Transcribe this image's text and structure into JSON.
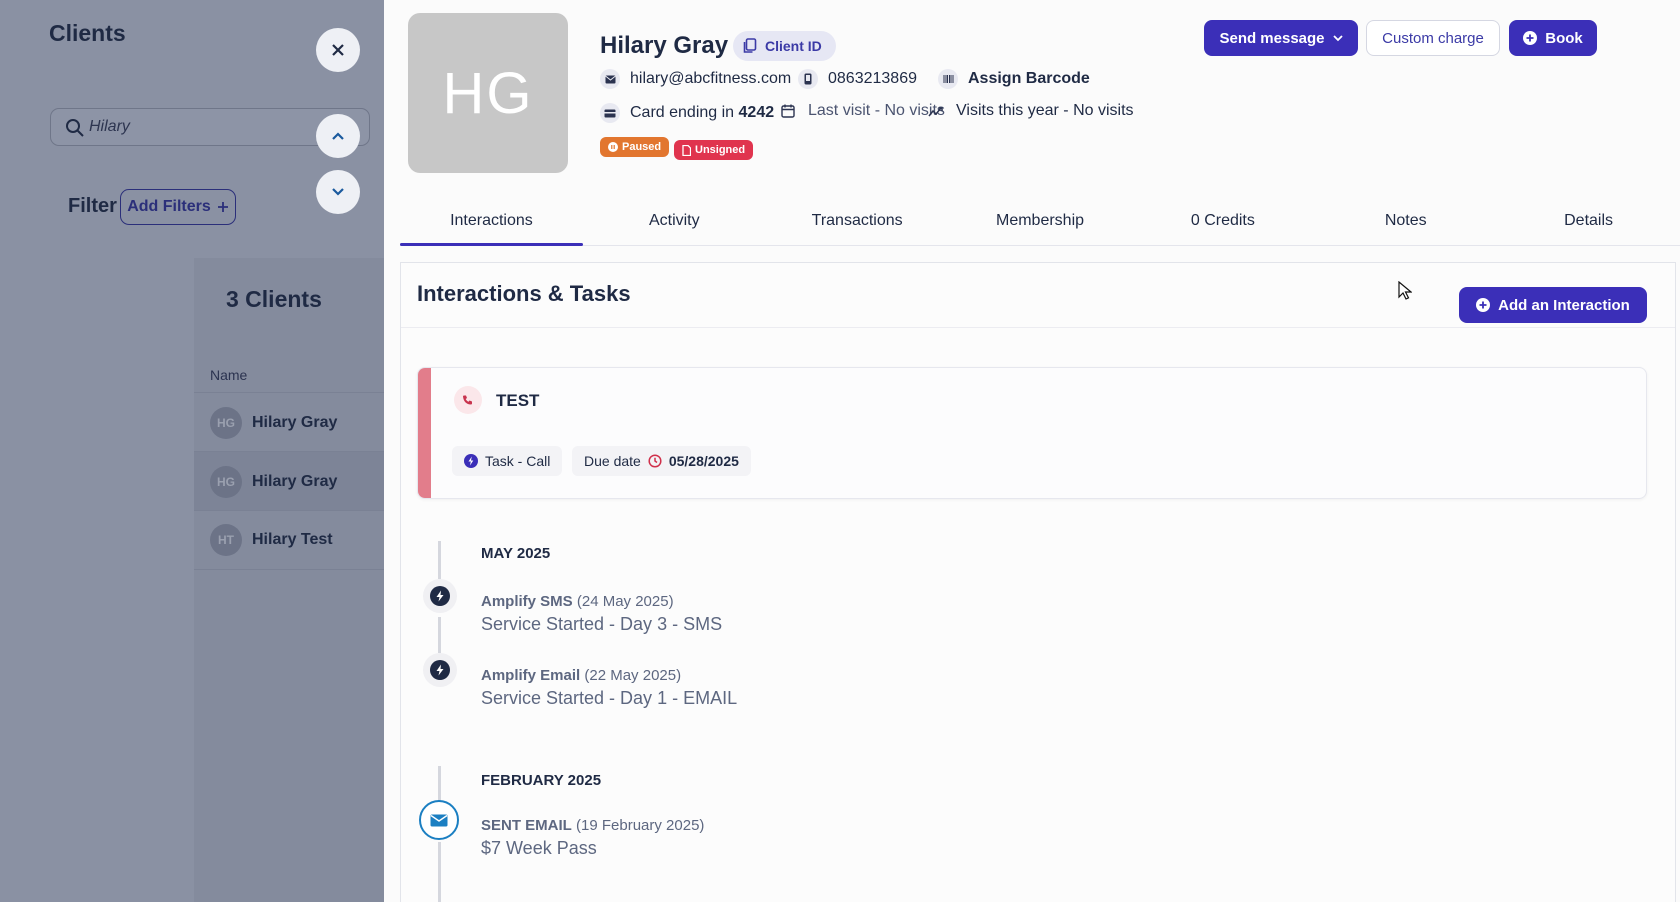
{
  "sidebar": {
    "title": "Clients",
    "search_value": "Hilary",
    "filter_label": "Filter",
    "add_filters_label": "Add Filters",
    "count_label": "3 Clients",
    "name_header": "Name",
    "rows": [
      {
        "initials": "HG",
        "name": "Hilary Gray"
      },
      {
        "initials": "HG",
        "name": "Hilary Gray"
      },
      {
        "initials": "HT",
        "name": "Hilary Test"
      }
    ]
  },
  "client": {
    "initials": "HG",
    "name": "Hilary Gray",
    "client_id_label": "Client ID",
    "email": "hilary@abcfitness.com",
    "phone": "0863213869",
    "barcode_label": "Assign Barcode",
    "card_prefix": "Card ending in",
    "card_last4": "4242",
    "last_visit_label": "Last visit -",
    "last_visit_value": "No visits",
    "visits_year_label": "Visits this year - No visits",
    "badges": [
      {
        "label": "Paused",
        "color": "#e2762f"
      },
      {
        "label": "Unsigned",
        "color": "#e0344e"
      }
    ]
  },
  "actions": {
    "send_message": "Send message",
    "custom_charge": "Custom charge",
    "book": "Book"
  },
  "tabs": [
    {
      "label": "Interactions",
      "active": true
    },
    {
      "label": "Activity"
    },
    {
      "label": "Transactions"
    },
    {
      "label": "Membership"
    },
    {
      "label": "0 Credits"
    },
    {
      "label": "Notes"
    },
    {
      "label": "Details"
    }
  ],
  "interactions": {
    "title": "Interactions & Tasks",
    "add_label": "Add an Interaction",
    "task": {
      "title": "TEST",
      "type": "Task - Call",
      "due_label": "Due date",
      "due_value": "05/28/2025"
    },
    "timeline": [
      {
        "month": "MAY 2025"
      },
      {
        "title": "Amplify SMS",
        "date": "(24 May 2025)",
        "detail": "Service Started - Day 3 - SMS",
        "icon": "lightning-icon"
      },
      {
        "title": "Amplify Email",
        "date": "(22 May 2025)",
        "detail": "Service Started - Day 1 - EMAIL",
        "icon": "lightning-icon"
      },
      {
        "month": "FEBRUARY 2025"
      },
      {
        "title": "SENT EMAIL",
        "date": "(19 February 2025)",
        "detail": "$7 Week Pass",
        "icon": "envelope-icon"
      }
    ]
  },
  "colors": {
    "accent": "#3b2fb8",
    "task_bar": "#e27d8b",
    "email_ring": "#1b7fc2"
  }
}
